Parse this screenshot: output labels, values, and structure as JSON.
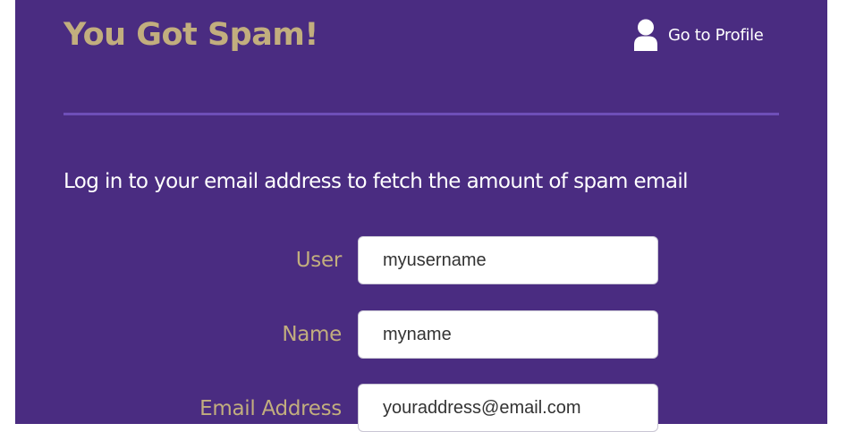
{
  "app": {
    "title": "You Got Spam!"
  },
  "header": {
    "profile_label": "Go to Profile",
    "profile_icon": "user-icon"
  },
  "intro": {
    "text": "Log in to your email address to fetch the amount of spam email"
  },
  "form": {
    "fields": [
      {
        "label": "User",
        "placeholder": "myusername"
      },
      {
        "label": "Name",
        "placeholder": "myname"
      },
      {
        "label": "Email Address",
        "placeholder": "youraddress@email.com"
      }
    ]
  },
  "colors": {
    "panel_background": "#4a2c81",
    "accent_gold": "#c2ae7e",
    "divider": "#6f4fb8",
    "text_white": "#ffffff"
  }
}
